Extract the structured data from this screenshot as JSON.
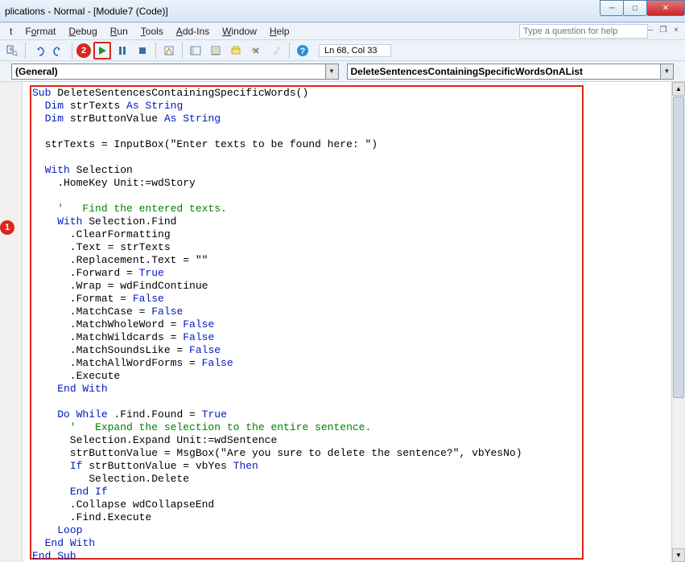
{
  "title": "plications - Normal - [Module7 (Code)]",
  "menus": {
    "edit": "t",
    "format": "Format",
    "debug": "Debug",
    "run": "Run",
    "tools": "Tools",
    "addins": "Add-Ins",
    "window": "Window",
    "help": "Help"
  },
  "help_placeholder": "Type a question for help",
  "badge2": "2",
  "badge1": "1",
  "cursor_pos": "Ln 68, Col 33",
  "combo_left": "(General)",
  "combo_right": "DeleteSentencesContainingSpecificWordsOnAList",
  "code": {
    "l1a": "Sub",
    "l1b": " DeleteSentencesContainingSpecificWords()",
    "l2a": "Dim",
    "l2b": " strTexts ",
    "l2c": "As String",
    "l3a": "Dim",
    "l3b": " strButtonValue ",
    "l3c": "As String",
    "l5": "  strTexts = InputBox(\"Enter texts to be found here: \")",
    "l7a": "With",
    "l7b": " Selection",
    "l8": "    .HomeKey Unit:=wdStory",
    "l10": "    '   Find the entered texts.",
    "l11a": "With",
    "l11b": " Selection.Find",
    "l12": "      .ClearFormatting",
    "l13": "      .Text = strTexts",
    "l14": "      .Replacement.Text = \"\"",
    "l15a": "      .Forward = ",
    "l15b": "True",
    "l16": "      .Wrap = wdFindContinue",
    "l17a": "      .Format = ",
    "l17b": "False",
    "l18a": "      .MatchCase = ",
    "l18b": "False",
    "l19a": "      .MatchWholeWord = ",
    "l19b": "False",
    "l20a": "      .MatchWildcards = ",
    "l20b": "False",
    "l21a": "      .MatchSoundsLike = ",
    "l21b": "False",
    "l22a": "      .MatchAllWordForms = ",
    "l22b": "False",
    "l23": "      .Execute",
    "l24": "End With",
    "l26a": "Do While",
    "l26b": " .Find.Found = ",
    "l26c": "True",
    "l27": "      '   Expand the selection to the entire sentence.",
    "l28": "      Selection.Expand Unit:=wdSentence",
    "l29": "      strButtonValue = MsgBox(\"Are you sure to delete the sentence?\", vbYesNo)",
    "l30a": "If",
    "l30b": " strButtonValue = vbYes ",
    "l30c": "Then",
    "l31": "         Selection.Delete",
    "l32": "End If",
    "l33": "      .Collapse wdCollapseEnd",
    "l34": "      .Find.Execute",
    "l35": "Loop",
    "l36": "End With",
    "l37": "End Sub"
  }
}
